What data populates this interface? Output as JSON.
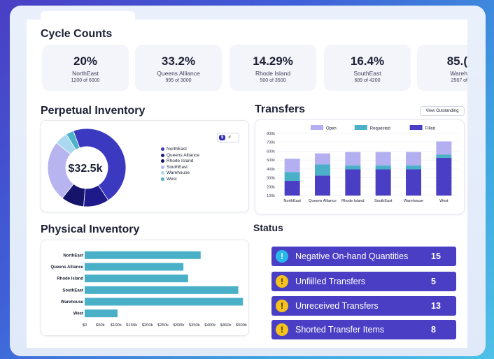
{
  "sections": {
    "cycle_counts": "Cycle Counts",
    "perpetual_inventory": "Perpetual Inventory",
    "transfers": "Transfers",
    "physical_inventory": "Physical Inventory",
    "status": "Status"
  },
  "kpis": [
    {
      "value": "20%",
      "label": "NorthEast",
      "sub": "1200 of 6000"
    },
    {
      "value": "33.2%",
      "label": "Queens Alliance",
      "sub": "995 of 3000"
    },
    {
      "value": "14.29%",
      "label": "Rhode Island",
      "sub": "500 of 3500"
    },
    {
      "value": "16.4%",
      "label": "SouthEast",
      "sub": "689 of 4200"
    },
    {
      "value": "85.(",
      "label": "Wareh",
      "sub": "2567 of"
    }
  ],
  "perpetual": {
    "center_value": "$32.5k",
    "toggle_on": "$",
    "toggle_off": "#",
    "legend": [
      {
        "label": "NorthEast",
        "color": "#3b39c0"
      },
      {
        "label": "Queens Alliance",
        "color": "#1e1a8c"
      },
      {
        "label": "Rhode Island",
        "color": "#15136a"
      },
      {
        "label": "SouthEast",
        "color": "#b7b4f0"
      },
      {
        "label": "Warehouse",
        "color": "#a9d8f0"
      },
      {
        "label": "West",
        "color": "#4cb3c9"
      }
    ]
  },
  "transfers": {
    "button_label": "View Outstanding",
    "legend": [
      {
        "label": "Open",
        "color": "#b3aff0"
      },
      {
        "label": "Requested",
        "color": "#4ab0c8"
      },
      {
        "label": "Filled",
        "color": "#4a3fc4"
      }
    ]
  },
  "status": {
    "items": [
      {
        "name": "Negative On-hand Quantities",
        "count": "15",
        "icon": "info-icon",
        "icon_color": "#26b8ec"
      },
      {
        "name": "Unfiilled Transfers",
        "count": "5",
        "icon": "warning-icon",
        "icon_color": "#f4c21b"
      },
      {
        "name": "Unreceived Transfers",
        "count": "13",
        "icon": "warning-icon",
        "icon_color": "#f4c21b"
      },
      {
        "name": "Shorted Transfer Items",
        "count": "8",
        "icon": "warning-icon",
        "icon_color": "#f4c21b"
      }
    ]
  },
  "chart_data": [
    {
      "type": "pie",
      "title": "",
      "categories": [
        "NorthEast",
        "Queens Alliance",
        "Rhode Island",
        "SouthEast",
        "Warehouse",
        "West"
      ],
      "values": [
        44,
        10,
        9,
        24,
        5,
        3
      ],
      "donut": true
    },
    {
      "type": "bar",
      "stacked": true,
      "categories": [
        "NorthEast",
        "Queens Alliance",
        "Rhode Island",
        "SouthEast",
        "Warehouse",
        "West"
      ],
      "series": [
        {
          "name": "Filled",
          "values": [
            165000,
            225000,
            295000,
            295000,
            295000,
            425000
          ]
        },
        {
          "name": "Requested",
          "values": [
            100000,
            125000,
            45000,
            45000,
            45000,
            35000
          ]
        },
        {
          "name": "Open",
          "values": [
            150000,
            125000,
            150000,
            150000,
            150000,
            150000
          ]
        }
      ],
      "ylim": [
        100000,
        800000
      ],
      "yticks": [
        "100k",
        "200k",
        "300k",
        "400k",
        "500k",
        "600k",
        "700k",
        "800k"
      ]
    },
    {
      "type": "bar",
      "orientation": "horizontal",
      "categories": [
        "NorthEast",
        "Queens Alliance",
        "Rhode Island",
        "SouthEast",
        "Warehouse",
        "West"
      ],
      "values": [
        370000,
        315000,
        330000,
        490000,
        505000,
        105000
      ],
      "xlim": [
        0,
        500000
      ],
      "xticks": [
        "$0",
        "$50k",
        "$100k",
        "$150k",
        "$200k",
        "$250k",
        "$300k",
        "$350k",
        "$400k",
        "$450k",
        "$500k"
      ]
    }
  ]
}
